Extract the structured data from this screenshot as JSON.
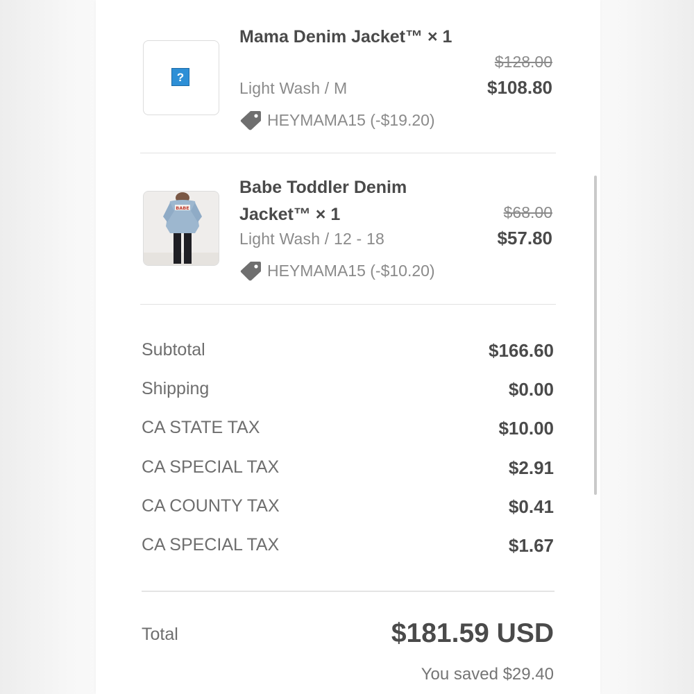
{
  "items": [
    {
      "name": "Mama Denim Jacket™ × 1",
      "variant": "Light Wash / M",
      "discount": "HEYMAMA15 (-$19.20)",
      "original_price": "$128.00",
      "price": "$108.80",
      "image_label": "?"
    },
    {
      "name": "Babe Toddler Denim Jacket™ × 1",
      "variant": "Light Wash / 12 - 18",
      "discount": "HEYMAMA15 (-$10.20)",
      "original_price": "$68.00",
      "price": "$57.80",
      "image_patch_text": "BABE"
    }
  ],
  "summary": [
    {
      "label": "Subtotal",
      "value": "$166.60"
    },
    {
      "label": "Shipping",
      "value": "$0.00"
    },
    {
      "label": "CA STATE TAX",
      "value": "$10.00"
    },
    {
      "label": "CA SPECIAL TAX",
      "value": "$2.91"
    },
    {
      "label": "CA COUNTY TAX",
      "value": "$0.41"
    },
    {
      "label": "CA SPECIAL TAX",
      "value": "$1.67"
    }
  ],
  "total": {
    "label": "Total",
    "value": "$181.59 USD",
    "saved": "You saved $29.40"
  },
  "icons": {
    "discount": "tag-icon",
    "missing_image": "broken-image-icon"
  },
  "colors": {
    "text_dark": "#4a4a4a",
    "text_muted": "#8a8a8a",
    "divider": "#e2e2e2",
    "broken_image_blue": "#2d8fd6"
  }
}
